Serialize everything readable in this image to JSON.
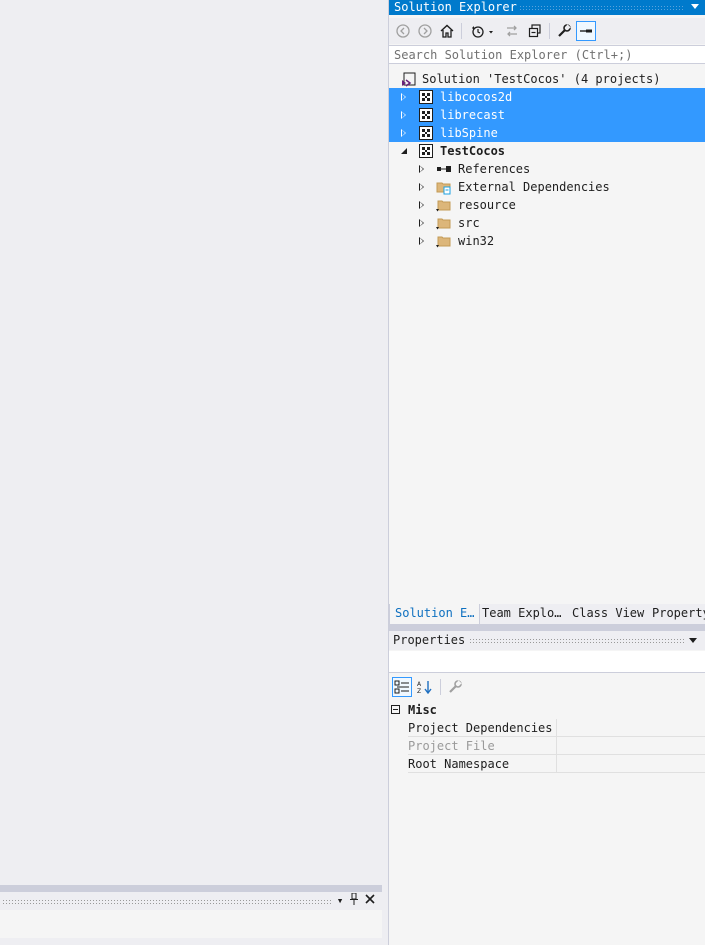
{
  "solution_explorer": {
    "title": "Solution Explorer",
    "search_placeholder": "Search Solution Explorer (Ctrl+;)",
    "tree": [
      {
        "label": "Solution 'TestCocos' (4 projects)",
        "icon": "solution-icon",
        "level": 0,
        "expander": "none",
        "selected": false,
        "bold": false
      },
      {
        "label": "libcocos2d",
        "icon": "cpp-project-icon",
        "level": 1,
        "expander": "collapsed",
        "selected": true,
        "bold": false
      },
      {
        "label": "librecast",
        "icon": "cpp-project-icon",
        "level": 1,
        "expander": "collapsed",
        "selected": true,
        "bold": false
      },
      {
        "label": "libSpine",
        "icon": "cpp-project-icon",
        "level": 1,
        "expander": "collapsed",
        "selected": true,
        "bold": false
      },
      {
        "label": "TestCocos",
        "icon": "cpp-project-icon",
        "level": 1,
        "expander": "expanded",
        "selected": false,
        "bold": true
      },
      {
        "label": "References",
        "icon": "references-icon",
        "level": 2,
        "expander": "collapsed",
        "selected": false,
        "bold": false
      },
      {
        "label": "External Dependencies",
        "icon": "external-dependencies-icon",
        "level": 2,
        "expander": "collapsed",
        "selected": false,
        "bold": false
      },
      {
        "label": "resource",
        "icon": "filter-folder-icon",
        "level": 2,
        "expander": "collapsed",
        "selected": false,
        "bold": false
      },
      {
        "label": "src",
        "icon": "filter-folder-icon",
        "level": 2,
        "expander": "collapsed",
        "selected": false,
        "bold": false
      },
      {
        "label": "win32",
        "icon": "filter-folder-icon",
        "level": 2,
        "expander": "collapsed",
        "selected": false,
        "bold": false
      }
    ]
  },
  "tabs": [
    {
      "label": "Solution E…",
      "active": true
    },
    {
      "label": "Team Explo…",
      "active": false
    },
    {
      "label": "Class View",
      "active": false
    },
    {
      "label": "Property",
      "active": false
    }
  ],
  "properties": {
    "title": "Properties",
    "category": "Misc",
    "rows": [
      {
        "name": "Project Dependencies",
        "value": "",
        "dim": false
      },
      {
        "name": "Project File",
        "value": "",
        "dim": true
      },
      {
        "name": "Root Namespace",
        "value": "",
        "dim": false
      }
    ]
  },
  "colors": {
    "accent": "#007acc",
    "selection": "#3399ff",
    "background": "#eeeef2"
  }
}
